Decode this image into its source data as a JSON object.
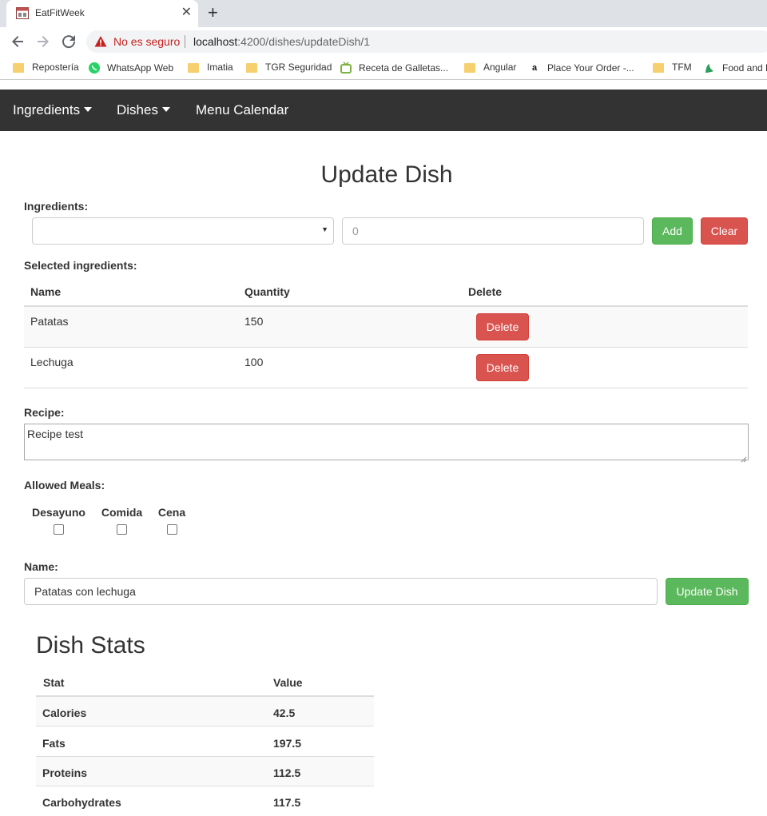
{
  "browser": {
    "tab_title": "EatFitWeek",
    "security_label": "No es seguro",
    "url_host": "localhost",
    "url_path": ":4200/dishes/updateDish/1",
    "bookmarks": [
      {
        "label": "Repostería",
        "icon": "folder-icon"
      },
      {
        "label": "WhatsApp Web",
        "icon": "whatsapp-icon"
      },
      {
        "label": "Imatia",
        "icon": "folder-icon"
      },
      {
        "label": "TGR Seguridad",
        "icon": "folder-icon"
      },
      {
        "label": "Receta de Galletas...",
        "icon": "recipe-site-icon"
      },
      {
        "label": "Angular",
        "icon": "folder-icon"
      },
      {
        "label": "Place Your Order -...",
        "icon": "amazon-icon"
      },
      {
        "label": "TFM",
        "icon": "folder-icon"
      },
      {
        "label": "Food and F",
        "icon": "food-site-icon"
      }
    ]
  },
  "navbar": {
    "items": [
      {
        "label": "Ingredients"
      },
      {
        "label": "Dishes"
      },
      {
        "label": "Menu Calendar"
      }
    ]
  },
  "page": {
    "title": "Update Dish",
    "ingredients_label": "Ingredients:",
    "ingredient_select_value": "",
    "quantity_placeholder": "0",
    "add_label": "Add",
    "clear_label": "Clear",
    "selected_label": "Selected ingredients:",
    "columns": [
      "Name",
      "Quantity",
      "Delete"
    ],
    "rows": [
      {
        "name": "Patatas",
        "quantity": "150",
        "action": "Delete"
      },
      {
        "name": "Lechuga",
        "quantity": "100",
        "action": "Delete"
      }
    ],
    "recipe_label": "Recipe:",
    "recipe_value": "Recipe test",
    "meals_label": "Allowed Meals:",
    "meals": [
      {
        "label": "Desayuno",
        "checked": false
      },
      {
        "label": "Comida",
        "checked": false
      },
      {
        "label": "Cena",
        "checked": false
      }
    ],
    "name_label": "Name:",
    "name_value": "Patatas con lechuga",
    "update_label": "Update Dish"
  },
  "stats": {
    "title": "Dish Stats",
    "columns": [
      "Stat",
      "Value"
    ],
    "rows": [
      {
        "stat": "Calories",
        "value": "42.5"
      },
      {
        "stat": "Fats",
        "value": "197.5"
      },
      {
        "stat": "Proteins",
        "value": "112.5"
      },
      {
        "stat": "Carbohydrates",
        "value": "117.5"
      }
    ]
  },
  "colors": {
    "navbar_bg": "#333333",
    "success": "#5cb85c",
    "danger": "#d9534f",
    "insecure_red": "#c5221f"
  }
}
